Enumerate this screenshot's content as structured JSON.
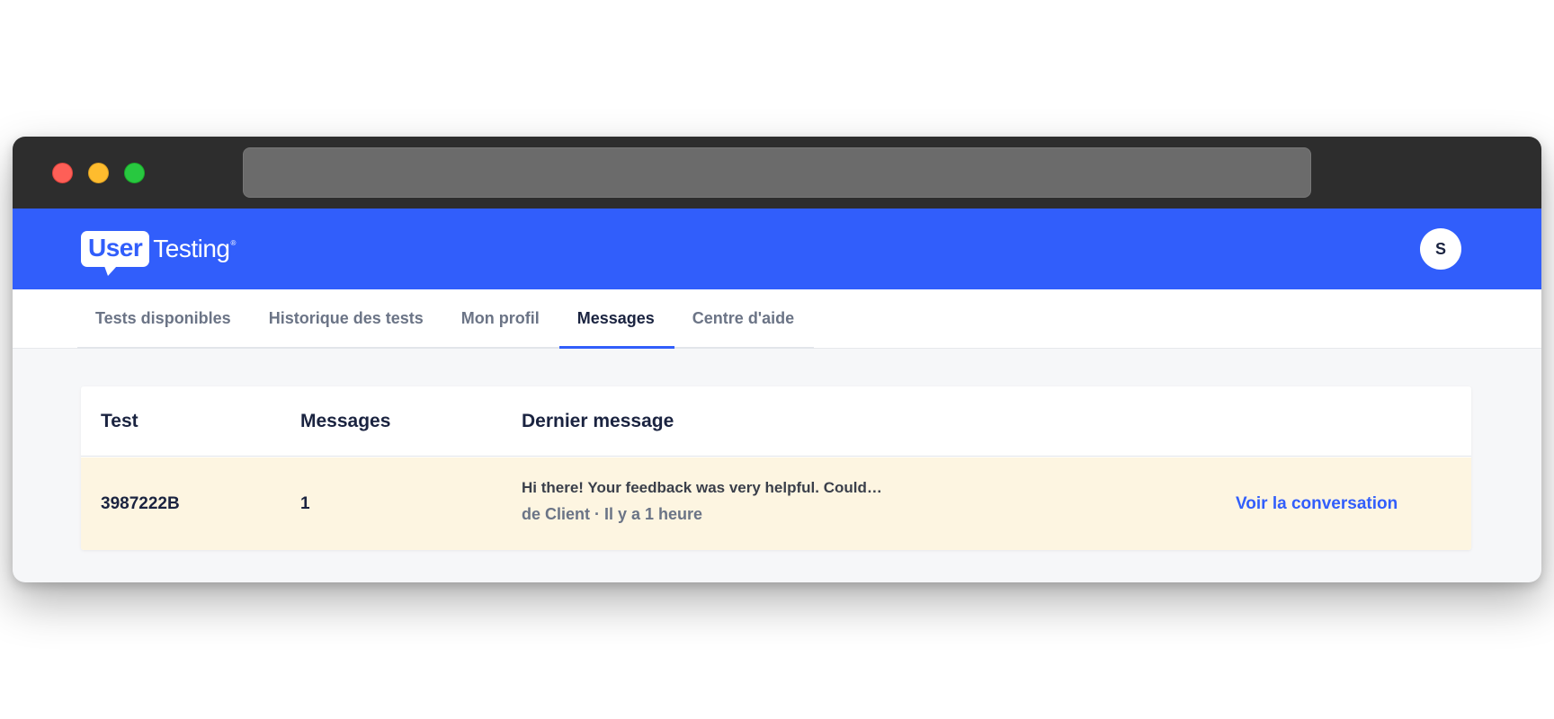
{
  "brand": {
    "logo_part1": "User",
    "logo_part2": "Testing",
    "logo_reg": "®",
    "color": "#315efb"
  },
  "user": {
    "avatar_initial": "S"
  },
  "nav": {
    "tabs": [
      {
        "label": "Tests disponibles",
        "active": false
      },
      {
        "label": "Historique des tests",
        "active": false
      },
      {
        "label": "Mon profil",
        "active": false
      },
      {
        "label": "Messages",
        "active": true
      },
      {
        "label": "Centre d'aide",
        "active": false
      }
    ]
  },
  "table": {
    "headers": {
      "test": "Test",
      "messages": "Messages",
      "last_message": "Dernier message"
    },
    "rows": [
      {
        "test": "3987222B",
        "messages": "1",
        "last_message_preview": "Hi there! Your feedback was very helpful. Could…",
        "last_message_meta": "de Client · Il y a 1 heure",
        "action": "Voir la conversation",
        "highlight_color": "#fdf5e1"
      }
    ]
  }
}
